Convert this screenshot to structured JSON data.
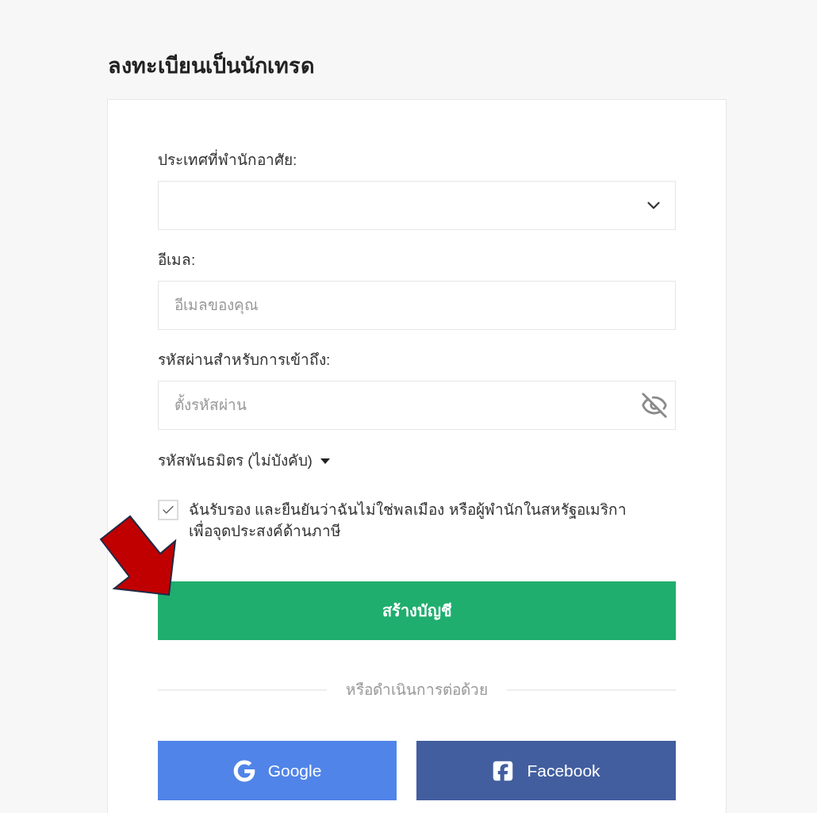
{
  "page_title": "ลงทะเบียนเป็นนักเทรด",
  "form": {
    "fields": [
      {
        "kind": "select",
        "label": "ประเทศที่พำนักอาศัย:"
      },
      {
        "kind": "text",
        "label": "อีเมล:",
        "placeholder": "อีเมลของคุณ"
      },
      {
        "kind": "password",
        "label": "รหัสผ่านสำหรับการเข้าถึง:",
        "placeholder": "ตั้งรหัสผ่าน",
        "revealed": false
      }
    ]
  },
  "referral": {
    "label": "รหัสพันธมิตร (ไม่บังคับ)",
    "expanded": false
  },
  "consent": {
    "checked": true,
    "text": "ฉันรับรอง และยืนยันว่าฉันไม่ใช่พลเมือง หรือผู้พำนักในสหรัฐอเมริกาเพื่อจุดประสงค์ด้านภาษี"
  },
  "submit_button": "สร้างบัญชี",
  "divider_text": "หรือดำเนินการต่อด้วย",
  "social_buttons": [
    {
      "kind": "google",
      "label": "Google"
    },
    {
      "kind": "facebook",
      "label": "Facebook"
    }
  ]
}
